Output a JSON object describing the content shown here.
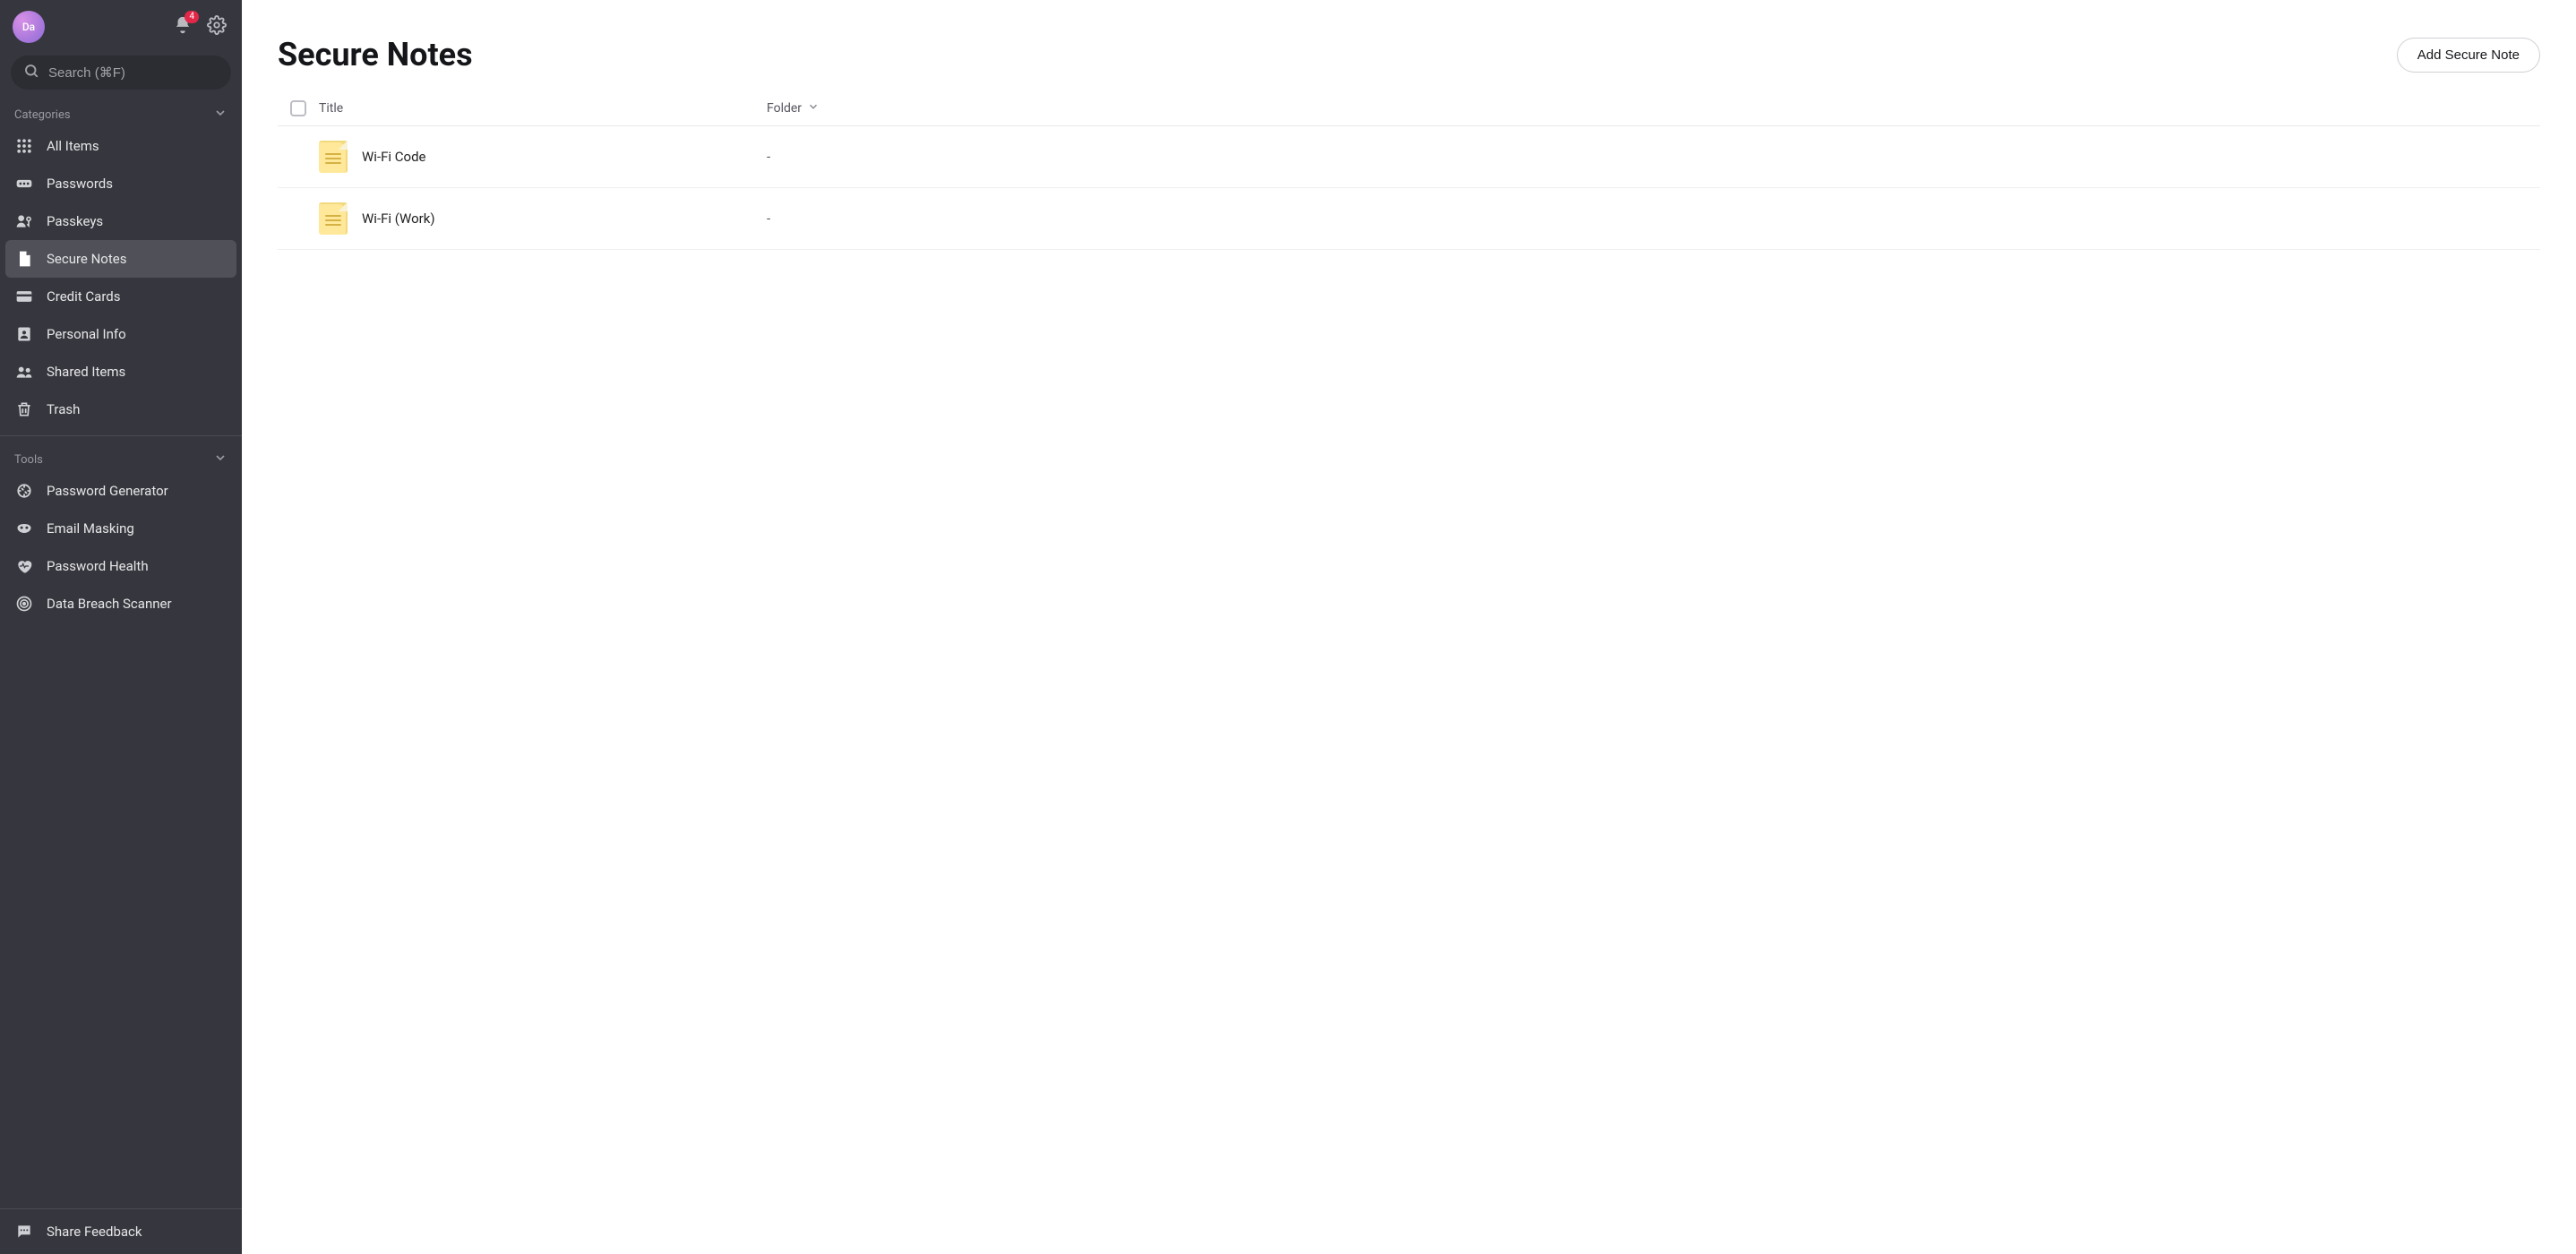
{
  "avatar_initials": "Da",
  "notification_count": "4",
  "search_placeholder": "Search (⌘F)",
  "categories_header": "Categories",
  "tools_header": "Tools",
  "categories": {
    "all_items": "All Items",
    "passwords": "Passwords",
    "passkeys": "Passkeys",
    "secure_notes": "Secure Notes",
    "credit_cards": "Credit Cards",
    "personal_info": "Personal Info",
    "shared_items": "Shared Items",
    "trash": "Trash"
  },
  "tools": {
    "password_generator": "Password Generator",
    "email_masking": "Email Masking",
    "password_health": "Password Health",
    "data_breach_scanner": "Data Breach Scanner"
  },
  "share_feedback": "Share Feedback",
  "page_title": "Secure Notes",
  "add_button": "Add Secure Note",
  "columns": {
    "title": "Title",
    "folder": "Folder"
  },
  "rows": [
    {
      "title": "Wi-Fi Code",
      "folder": "-"
    },
    {
      "title": "Wi-Fi (Work)",
      "folder": "-"
    }
  ]
}
